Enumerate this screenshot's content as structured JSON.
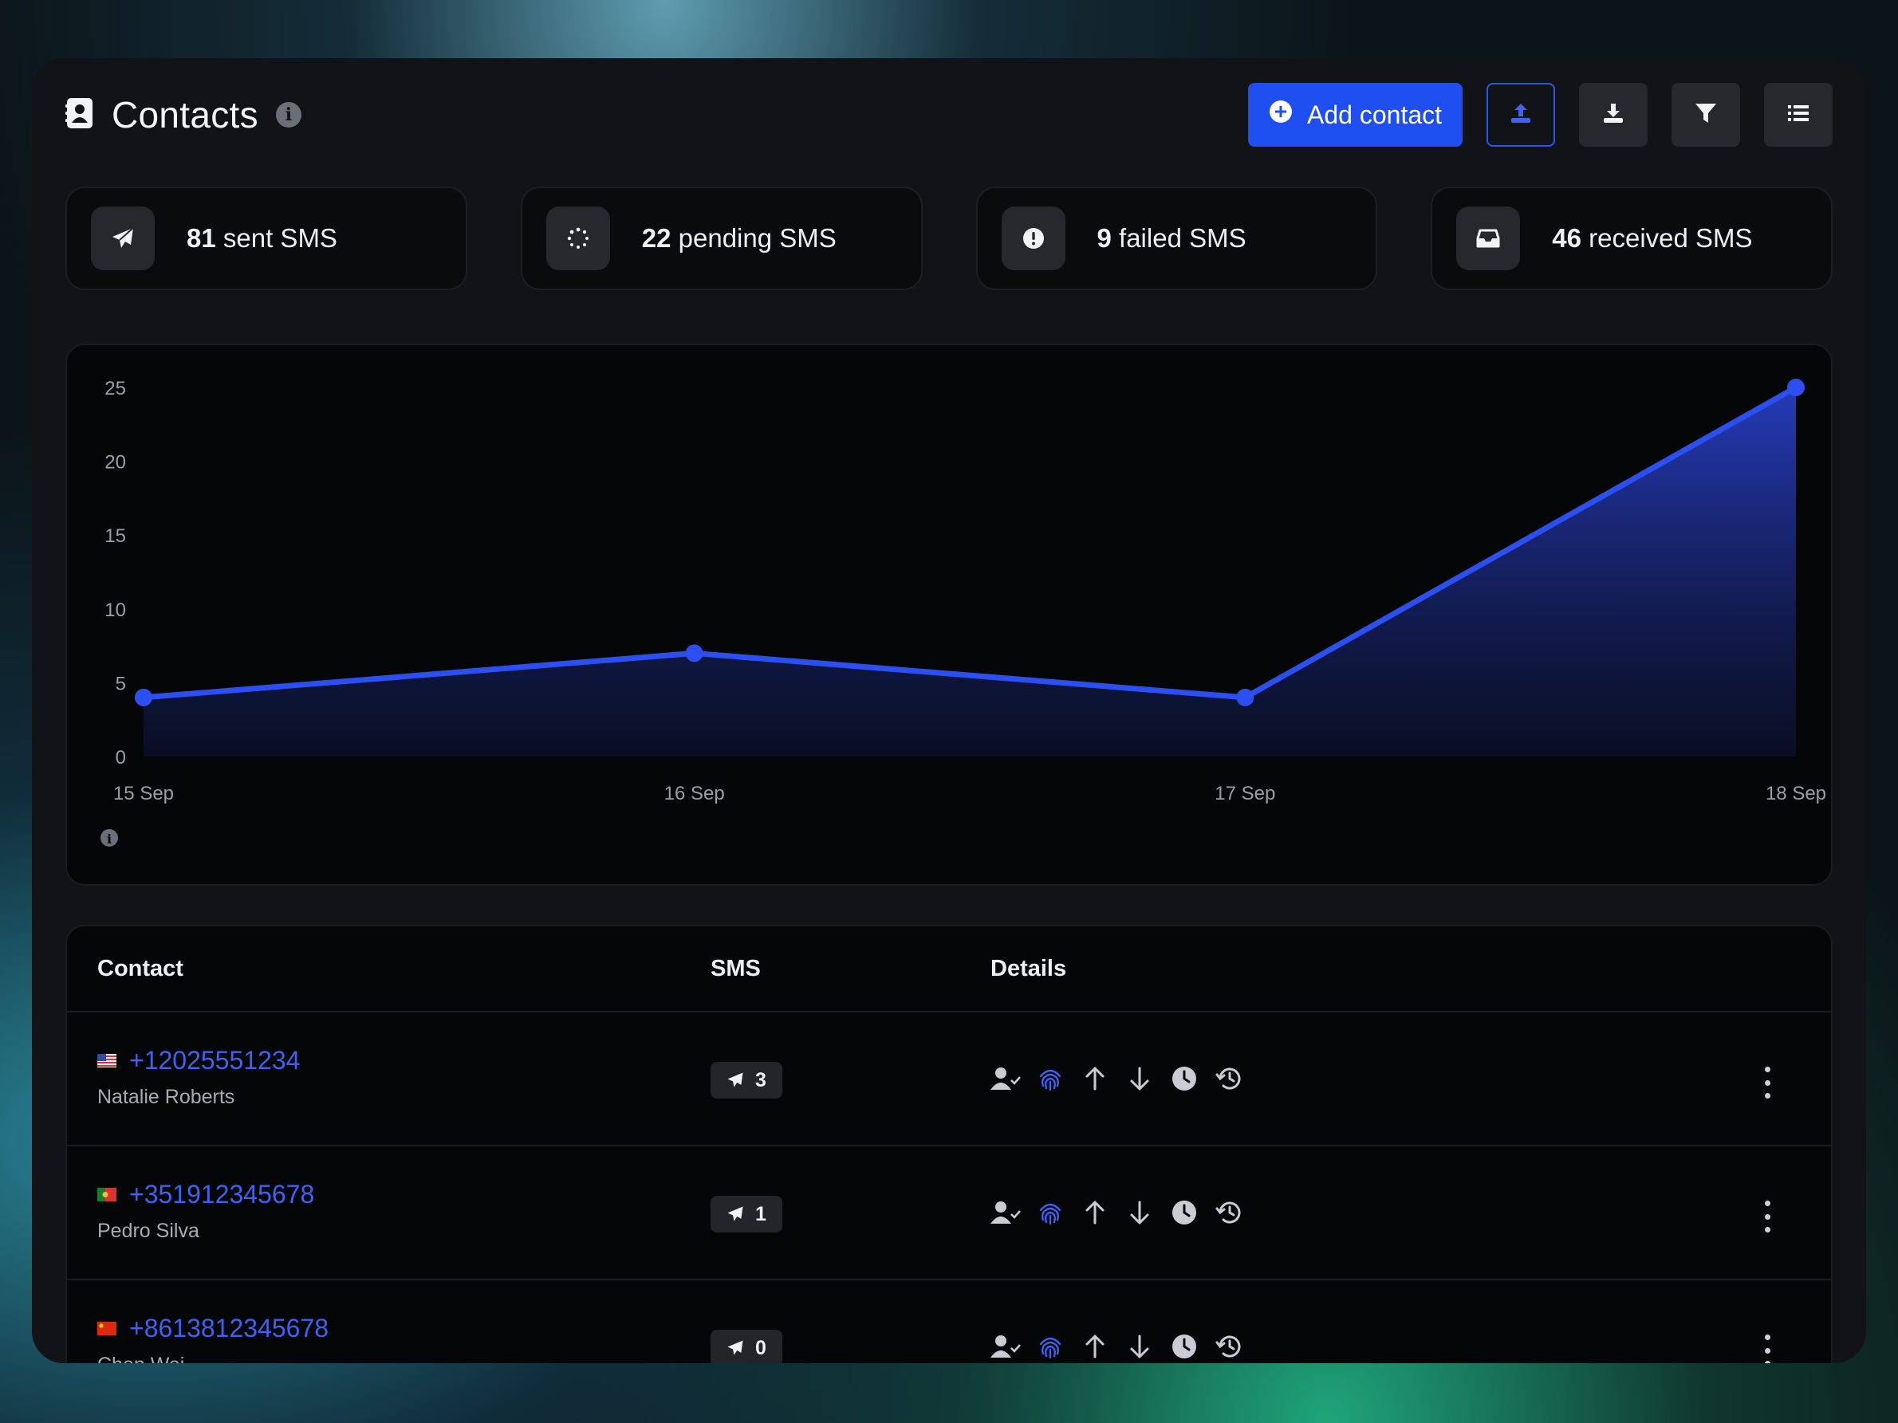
{
  "header": {
    "title": "Contacts",
    "info": "i",
    "add_contact_label": "Add contact",
    "accent": "#1f4ff0"
  },
  "stats": [
    {
      "value": "81",
      "label": "sent SMS",
      "icon": "paper-plane-icon"
    },
    {
      "value": "22",
      "label": "pending SMS",
      "icon": "spinner-icon"
    },
    {
      "value": "9",
      "label": "failed SMS",
      "icon": "alert-circle-icon"
    },
    {
      "value": "46",
      "label": "received SMS",
      "icon": "inbox-icon"
    }
  ],
  "chart_data": {
    "type": "area",
    "categories": [
      "15 Sep",
      "16 Sep",
      "17 Sep",
      "18 Sep"
    ],
    "values": [
      4,
      7,
      4,
      25
    ],
    "yticks": [
      0,
      5,
      10,
      15,
      20,
      25
    ],
    "ylim": [
      0,
      25
    ],
    "color": "#2b4ff0",
    "info": "i"
  },
  "table": {
    "headers": {
      "contact": "Contact",
      "sms": "SMS",
      "details": "Details"
    },
    "rows": [
      {
        "phone": "+12025551234",
        "name": "Natalie Roberts",
        "sms_count": "3",
        "flag": "us"
      },
      {
        "phone": "+351912345678",
        "name": "Pedro Silva",
        "sms_count": "1",
        "flag": "pt"
      },
      {
        "phone": "+8613812345678",
        "name": "Chen Wei",
        "sms_count": "0",
        "flag": "cn"
      }
    ]
  }
}
